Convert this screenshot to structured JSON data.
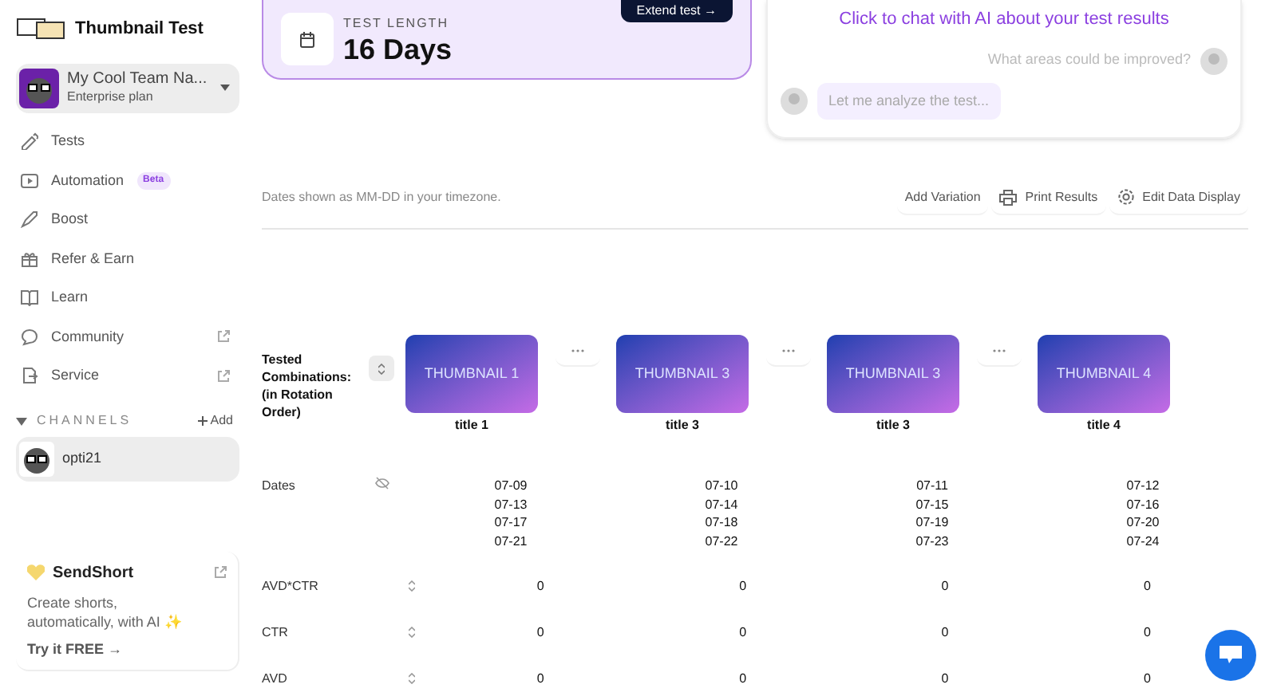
{
  "app": {
    "title": "Thumbnail Test"
  },
  "team": {
    "name": "My Cool Team Na...",
    "plan": "Enterprise plan"
  },
  "nav": [
    {
      "kind": "tests",
      "label": "Tests",
      "external": false
    },
    {
      "kind": "automation",
      "label": "Automation",
      "badge": "Beta",
      "external": false
    },
    {
      "kind": "boost",
      "label": "Boost",
      "external": false
    },
    {
      "kind": "refer",
      "label": "Refer & Earn",
      "external": false
    },
    {
      "kind": "learn",
      "label": "Learn",
      "external": false
    },
    {
      "kind": "community",
      "label": "Community",
      "external": true
    },
    {
      "kind": "service",
      "label": "Service",
      "external": true
    }
  ],
  "channels": {
    "heading": "CHANNELS",
    "expanded": true,
    "add": "Add",
    "items": [
      {
        "name": "opti21",
        "selected": true
      }
    ]
  },
  "promo": {
    "name": "SendShort",
    "text": "Create shorts, automatically, with AI ✨",
    "cta": "Try it FREE →"
  },
  "test_length": {
    "label": "TEST LENGTH",
    "value": "16 Days",
    "button": "Extend test →"
  },
  "chat": {
    "title": "Click to chat with AI about your test results",
    "messages": [
      {
        "kind": "user",
        "text": "What areas could be improved?"
      },
      {
        "kind": "ai",
        "text": "Let me analyze the test..."
      }
    ]
  },
  "note": "Dates shown as MM-DD in your timezone.",
  "actions": [
    {
      "kind": "plain",
      "label": "Add Variation"
    },
    {
      "kind": "print",
      "label": "Print Results"
    },
    {
      "kind": "settings",
      "label": "Edit Data Display"
    }
  ],
  "table": {
    "header": "Tested Combinations: (in Rotation Order)",
    "dates_label": "Dates",
    "variations": [
      {
        "thumbnail": "THUMBNAIL 1",
        "title": "title 1",
        "dates": [
          "07-09",
          "07-13",
          "07-17",
          "07-21"
        ]
      },
      {
        "thumbnail": "THUMBNAIL 3",
        "title": "title 3",
        "dates": [
          "07-10",
          "07-14",
          "07-18",
          "07-22"
        ]
      },
      {
        "thumbnail": "THUMBNAIL 3",
        "title": "title 3",
        "dates": [
          "07-11",
          "07-15",
          "07-19",
          "07-23"
        ]
      },
      {
        "thumbnail": "THUMBNAIL 4",
        "title": "title 4",
        "dates": [
          "07-12",
          "07-16",
          "07-20",
          "07-24"
        ]
      }
    ],
    "rows": [
      {
        "label": "AVD*CTR",
        "values": [
          "0",
          "0",
          "0",
          "0"
        ]
      },
      {
        "label": "CTR",
        "values": [
          "0",
          "0",
          "0",
          "0"
        ]
      },
      {
        "label": "AVD",
        "values": [
          "0",
          "0",
          "0",
          "0"
        ]
      }
    ]
  }
}
